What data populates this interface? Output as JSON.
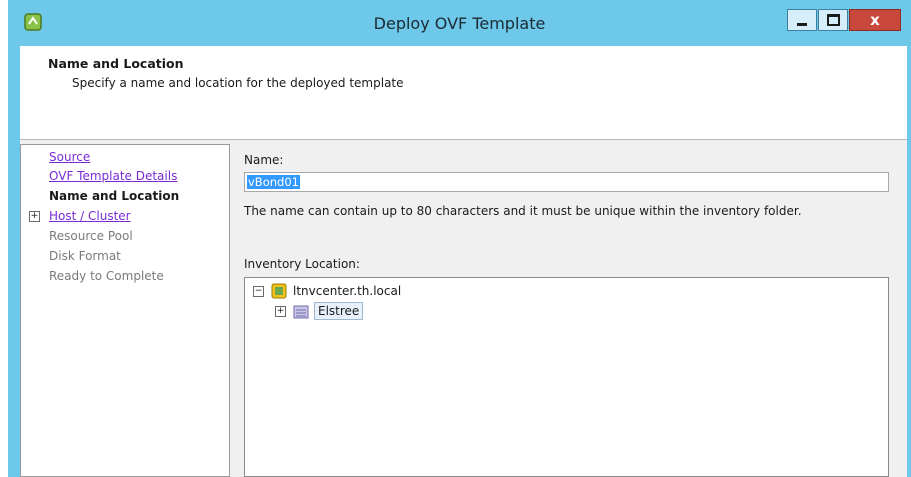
{
  "window": {
    "title": "Deploy OVF Template",
    "close_glyph": "x"
  },
  "header": {
    "title": "Name and Location",
    "subtitle": "Specify a name and location for the deployed template"
  },
  "steps": [
    {
      "label": "Source",
      "state": "link"
    },
    {
      "label": "OVF Template Details",
      "state": "link"
    },
    {
      "label": "Name and Location",
      "state": "current"
    },
    {
      "label": "Host / Cluster",
      "state": "link",
      "expander": "+"
    },
    {
      "label": "Resource Pool",
      "state": "disabled"
    },
    {
      "label": "Disk Format",
      "state": "disabled"
    },
    {
      "label": "Ready to Complete",
      "state": "disabled"
    }
  ],
  "form": {
    "name_label": "Name:",
    "name_value": "vBond01",
    "help_text": "The name can contain up to 80 characters and it must be unique within the inventory folder.",
    "inventory_label": "Inventory Location:"
  },
  "tree": {
    "root": {
      "label": "ltnvcenter.th.local",
      "expander": "−",
      "icon": "vcenter-icon"
    },
    "child": {
      "label": "Elstree",
      "expander": "+",
      "icon": "datacenter-icon"
    }
  },
  "colors": {
    "title_bar": "#6ec8ea",
    "close_button": "#c7473a",
    "link": "#7a2bd6",
    "selection": "#3399ff"
  }
}
